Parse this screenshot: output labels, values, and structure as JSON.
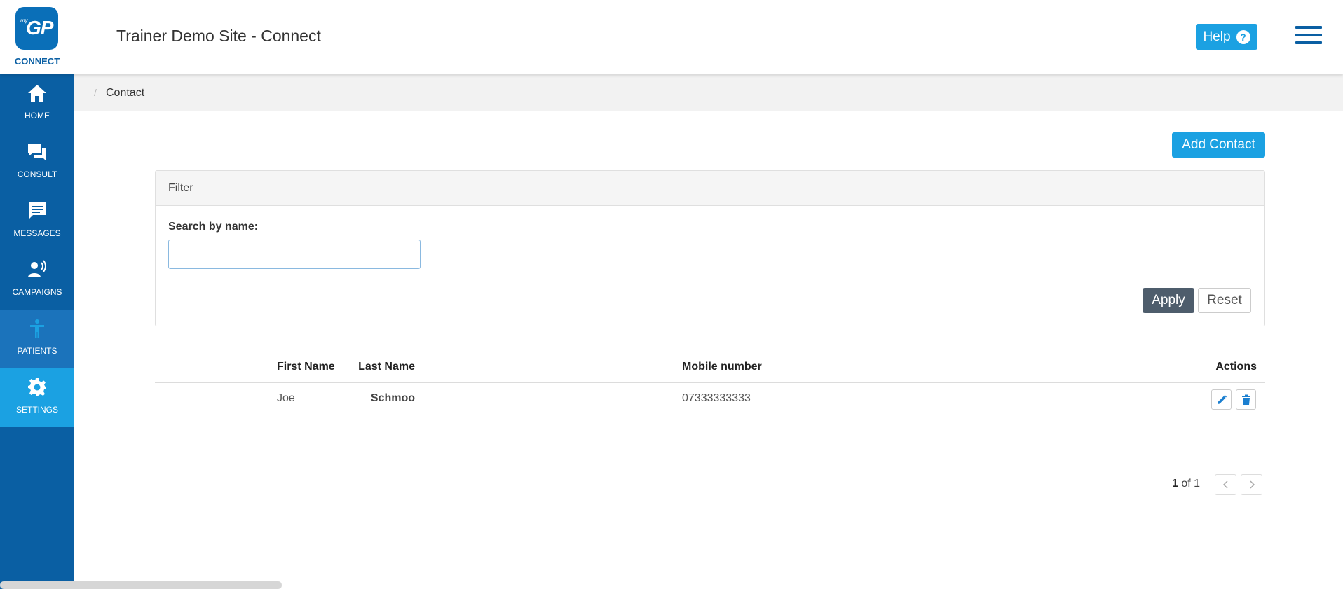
{
  "header": {
    "logo_small": "my",
    "logo_main": "GP",
    "logo_caption": "CONNECT",
    "site_title": "Trainer Demo Site - Connect",
    "help_label": "Help",
    "help_icon_glyph": "?"
  },
  "sidebar": {
    "items": [
      {
        "label": "HOME",
        "icon": "home-icon"
      },
      {
        "label": "CONSULT",
        "icon": "chat-bubbles-icon"
      },
      {
        "label": "MESSAGES",
        "icon": "message-icon"
      },
      {
        "label": "CAMPAIGNS",
        "icon": "broadcast-person-icon"
      },
      {
        "label": "PATIENTS",
        "icon": "person-icon"
      },
      {
        "label": "SETTINGS",
        "icon": "gear-icon"
      }
    ],
    "active": "SETTINGS"
  },
  "breadcrumb": {
    "separator": "/",
    "current": "Contact"
  },
  "main": {
    "add_contact_label": "Add Contact",
    "filter": {
      "title": "Filter",
      "search_label": "Search by name:",
      "search_value": "",
      "search_placeholder": "",
      "apply_label": "Apply",
      "reset_label": "Reset"
    },
    "table": {
      "columns": [
        "Last Name",
        "First Name",
        "Mobile number",
        "Actions"
      ],
      "rows": [
        {
          "last_name": "Schmoo",
          "first_name": "Joe",
          "mobile": "07333333333"
        }
      ]
    },
    "pagination": {
      "current": "1",
      "of_text": "of 1"
    }
  },
  "colors": {
    "sidebar": "#0a5fa3",
    "accent": "#1ba1e2",
    "apply": "#4e5d6c"
  }
}
